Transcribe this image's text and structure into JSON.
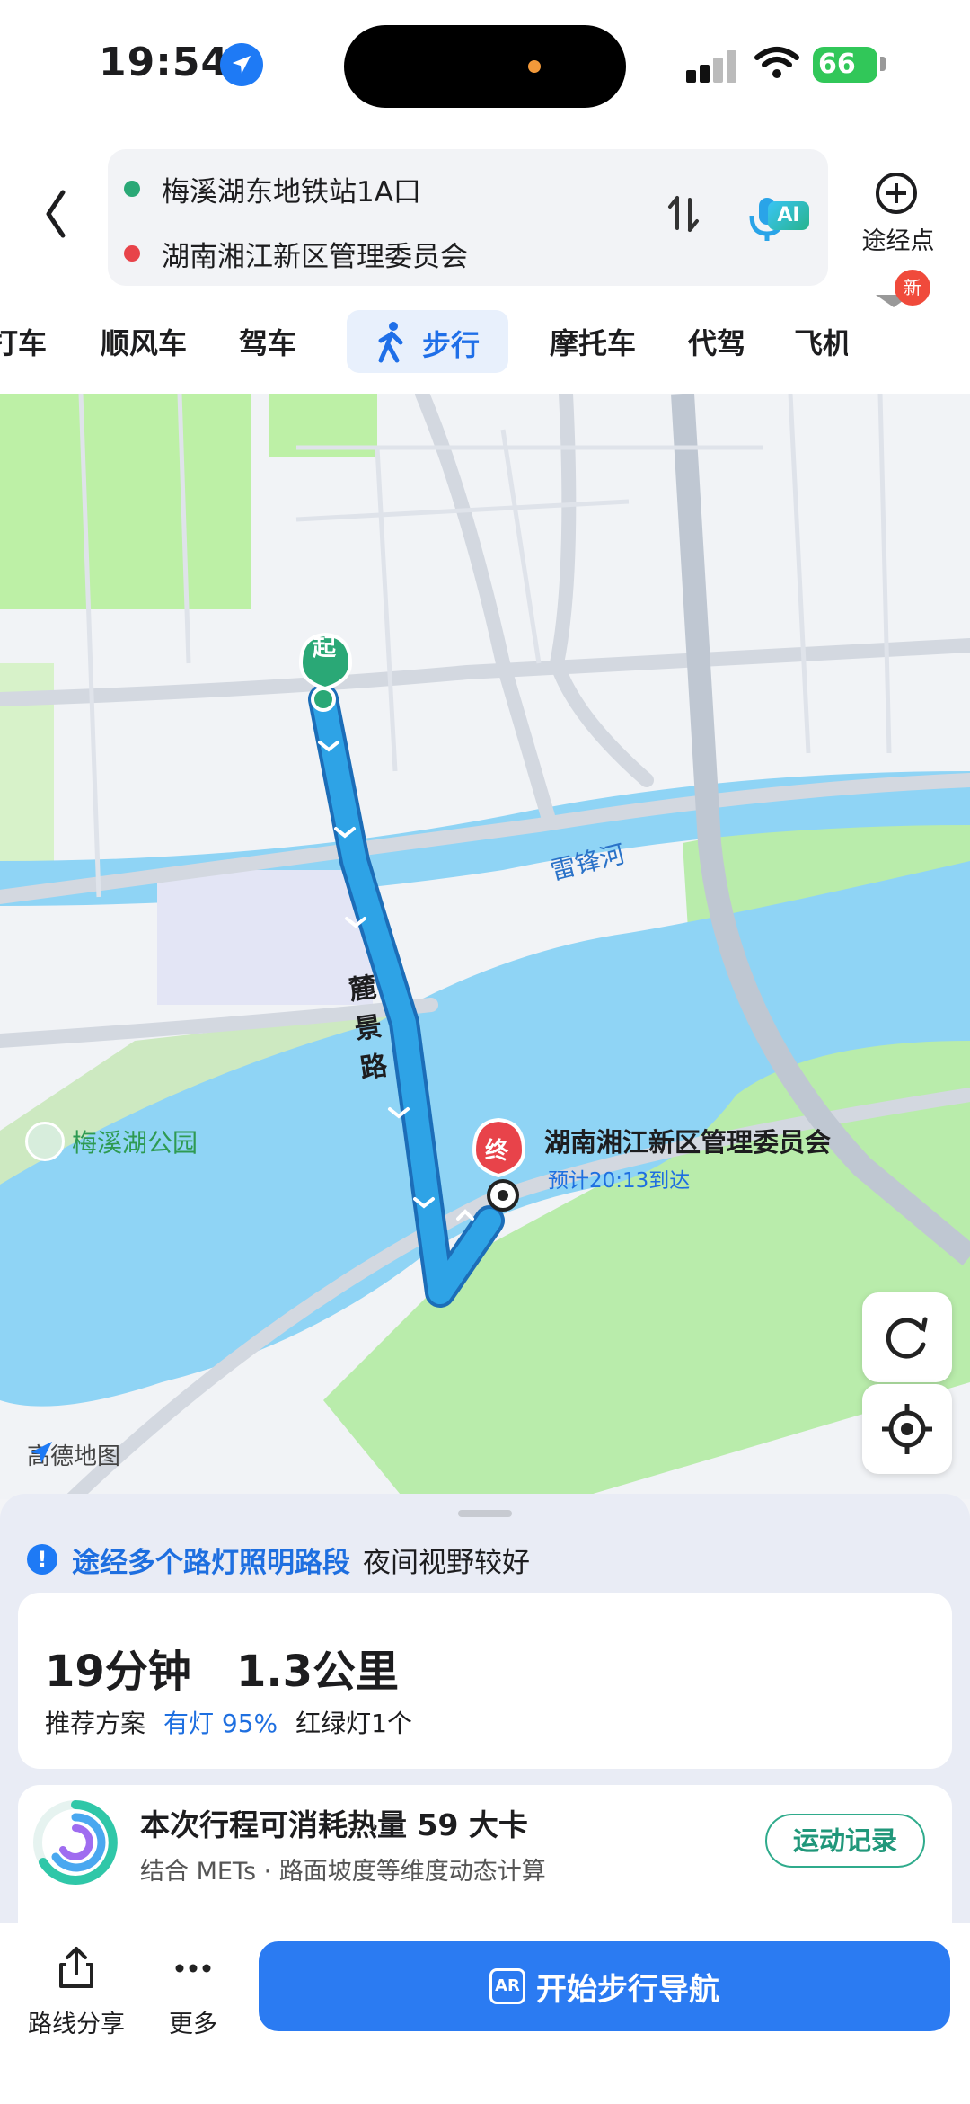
{
  "status": {
    "time": "19:54",
    "battery": "66"
  },
  "route": {
    "start": "梅溪湖东地铁站1A口",
    "end": "湖南湘江新区管理委员会",
    "waypoint_label": "途经点",
    "ai_badge": "AI"
  },
  "tabs": [
    {
      "label": "打车"
    },
    {
      "label": "顺风车"
    },
    {
      "label": "驾车"
    },
    {
      "label": "步行",
      "active": true
    },
    {
      "label": "摩托车"
    },
    {
      "label": "代驾"
    },
    {
      "label": "飞机"
    }
  ],
  "new_badge": "新",
  "map": {
    "start_marker": "起",
    "end_marker": "终",
    "road_name": "麓景路",
    "river_name": "雷锋河",
    "park_name": "梅溪湖公园",
    "destination_name": "湖南湘江新区管理委员会",
    "eta_text": "预计20:13到达",
    "brand": "高德地图"
  },
  "tip": {
    "highlight": "途经多个路灯照明路段",
    "text": "夜间视野较好"
  },
  "trip": {
    "duration": "19分钟",
    "distance": "1.3公里",
    "plan_label": "推荐方案",
    "light_info": "有灯 95%",
    "traffic_lights": "红绿灯1个"
  },
  "calories": {
    "title": "本次行程可消耗热量 59 大卡",
    "subtitle": "结合 METs · 路面坡度等维度动态计算",
    "button": "运动记录"
  },
  "bottom": {
    "share_label": "路线分享",
    "more_label": "更多",
    "nav_label": "开始步行导航",
    "ar_label": "AR"
  },
  "colors": {
    "accent": "#2b7bf2",
    "route_line": "#2ea3e6",
    "water": "#8fd4f5",
    "green": "#a7e39b",
    "start_green": "#2aa876",
    "end_red": "#e8434a"
  }
}
